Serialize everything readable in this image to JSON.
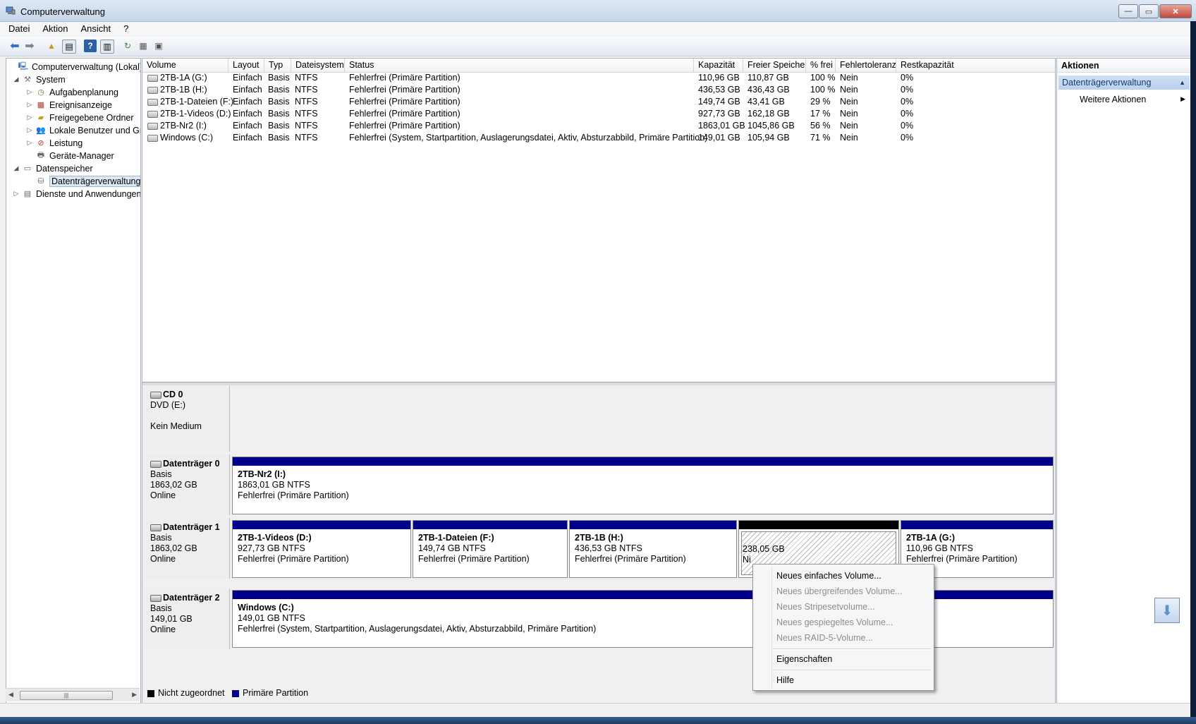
{
  "window": {
    "title": "Computerverwaltung"
  },
  "menu": [
    "Datei",
    "Aktion",
    "Ansicht",
    "?"
  ],
  "tree": {
    "items": [
      {
        "label": "Computerverwaltung (Lokal)",
        "icon": "computer-icon",
        "level": 0,
        "exp": ""
      },
      {
        "label": "System",
        "icon": "tools-icon",
        "level": 1,
        "exp": "◢"
      },
      {
        "label": "Aufgabenplanung",
        "icon": "clock-icon",
        "level": 2,
        "exp": "▷"
      },
      {
        "label": "Ereignisanzeige",
        "icon": "event-icon",
        "level": 2,
        "exp": "▷"
      },
      {
        "label": "Freigegebene Ordner",
        "icon": "shared-folder-icon",
        "level": 2,
        "exp": "▷"
      },
      {
        "label": "Lokale Benutzer und Gruppen",
        "icon": "users-icon",
        "level": 2,
        "exp": "▷"
      },
      {
        "label": "Leistung",
        "icon": "performance-icon",
        "level": 2,
        "exp": "▷"
      },
      {
        "label": "Geräte-Manager",
        "icon": "device-manager-icon",
        "level": 2,
        "exp": ""
      },
      {
        "label": "Datenspeicher",
        "icon": "storage-icon",
        "level": 1,
        "exp": "◢"
      },
      {
        "label": "Datenträgerverwaltung",
        "icon": "disk-management-icon",
        "level": 2,
        "exp": "",
        "selected": true
      },
      {
        "label": "Dienste und Anwendungen",
        "icon": "services-icon",
        "level": 1,
        "exp": "▷"
      }
    ]
  },
  "volume_table": {
    "headers": [
      "Volume",
      "Layout",
      "Typ",
      "Dateisystem",
      "Status",
      "Kapazität",
      "Freier Speicher",
      "% frei",
      "Fehlertoleranz",
      "Restkapazität"
    ],
    "rows": [
      [
        "2TB-1A (G:)",
        "Einfach",
        "Basis",
        "NTFS",
        "Fehlerfrei (Primäre Partition)",
        "110,96 GB",
        "110,87 GB",
        "100 %",
        "Nein",
        "0%"
      ],
      [
        "2TB-1B (H:)",
        "Einfach",
        "Basis",
        "NTFS",
        "Fehlerfrei (Primäre Partition)",
        "436,53 GB",
        "436,43 GB",
        "100 %",
        "Nein",
        "0%"
      ],
      [
        "2TB-1-Dateien (F:)",
        "Einfach",
        "Basis",
        "NTFS",
        "Fehlerfrei (Primäre Partition)",
        "149,74 GB",
        "43,41 GB",
        "29 %",
        "Nein",
        "0%"
      ],
      [
        "2TB-1-Videos (D:)",
        "Einfach",
        "Basis",
        "NTFS",
        "Fehlerfrei (Primäre Partition)",
        "927,73 GB",
        "162,18 GB",
        "17 %",
        "Nein",
        "0%"
      ],
      [
        "2TB-Nr2 (I:)",
        "Einfach",
        "Basis",
        "NTFS",
        "Fehlerfrei (Primäre Partition)",
        "1863,01 GB",
        "1045,86 GB",
        "56 %",
        "Nein",
        "0%"
      ],
      [
        "Windows (C:)",
        "Einfach",
        "Basis",
        "NTFS",
        "Fehlerfrei (System, Startpartition, Auslagerungsdatei, Aktiv, Absturzabbild, Primäre Partition)",
        "149,01 GB",
        "105,94 GB",
        "71 %",
        "Nein",
        "0%"
      ]
    ]
  },
  "disks": [
    {
      "name": "CD 0",
      "line1": "DVD (E:)",
      "line2": "",
      "line3": "Kein Medium"
    },
    {
      "name": "Datenträger 0",
      "line1": "Basis",
      "line2": "1863,02 GB",
      "line3": "Online",
      "parts": [
        {
          "name": "2TB-Nr2  (I:)",
          "size": "1863,01 GB NTFS",
          "status": "Fehlerfrei (Primäre Partition)"
        }
      ]
    },
    {
      "name": "Datenträger 1",
      "line1": "Basis",
      "line2": "1863,02 GB",
      "line3": "Online",
      "parts": [
        {
          "name": "2TB-1-Videos  (D:)",
          "size": "927,73 GB NTFS",
          "status": "Fehlerfrei (Primäre Partition)"
        },
        {
          "name": "2TB-1-Dateien  (F:)",
          "size": "149,74 GB NTFS",
          "status": "Fehlerfrei (Primäre Partition)"
        },
        {
          "name": "2TB-1B  (H:)",
          "size": "436,53 GB NTFS",
          "status": "Fehlerfrei (Primäre Partition)"
        },
        {
          "name": "",
          "size": "238,05 GB",
          "status": "Ni"
        },
        {
          "name": "2TB-1A  (G:)",
          "size": "110,96 GB NTFS",
          "status": "Fehlerfrei (Primäre Partition)"
        }
      ]
    },
    {
      "name": "Datenträger 2",
      "line1": "Basis",
      "line2": "149,01 GB",
      "line3": "Online",
      "parts": [
        {
          "name": "Windows  (C:)",
          "size": "149,01 GB NTFS",
          "status": "Fehlerfrei (System, Startpartition, Auslagerungsdatei, Aktiv, Absturzabbild, Primäre Partition)"
        }
      ]
    }
  ],
  "legend": {
    "unallocated": "Nicht zugeordnet",
    "primary": "Primäre Partition",
    "unallocated_color": "#000000",
    "primary_color": "#00008b"
  },
  "actions": {
    "header": "Aktionen",
    "section": "Datenträgerverwaltung",
    "more": "Weitere Aktionen"
  },
  "context_menu": {
    "items": [
      {
        "label": "Neues einfaches Volume...",
        "enabled": true
      },
      {
        "label": "Neues übergreifendes Volume...",
        "enabled": false
      },
      {
        "label": "Neues Stripesetvolume...",
        "enabled": false
      },
      {
        "label": "Neues gespiegeltes Volume...",
        "enabled": false
      },
      {
        "label": "Neues RAID-5-Volume...",
        "enabled": false
      },
      {
        "label": "Eigenschaften",
        "enabled": true
      },
      {
        "label": "Hilfe",
        "enabled": true
      }
    ]
  }
}
